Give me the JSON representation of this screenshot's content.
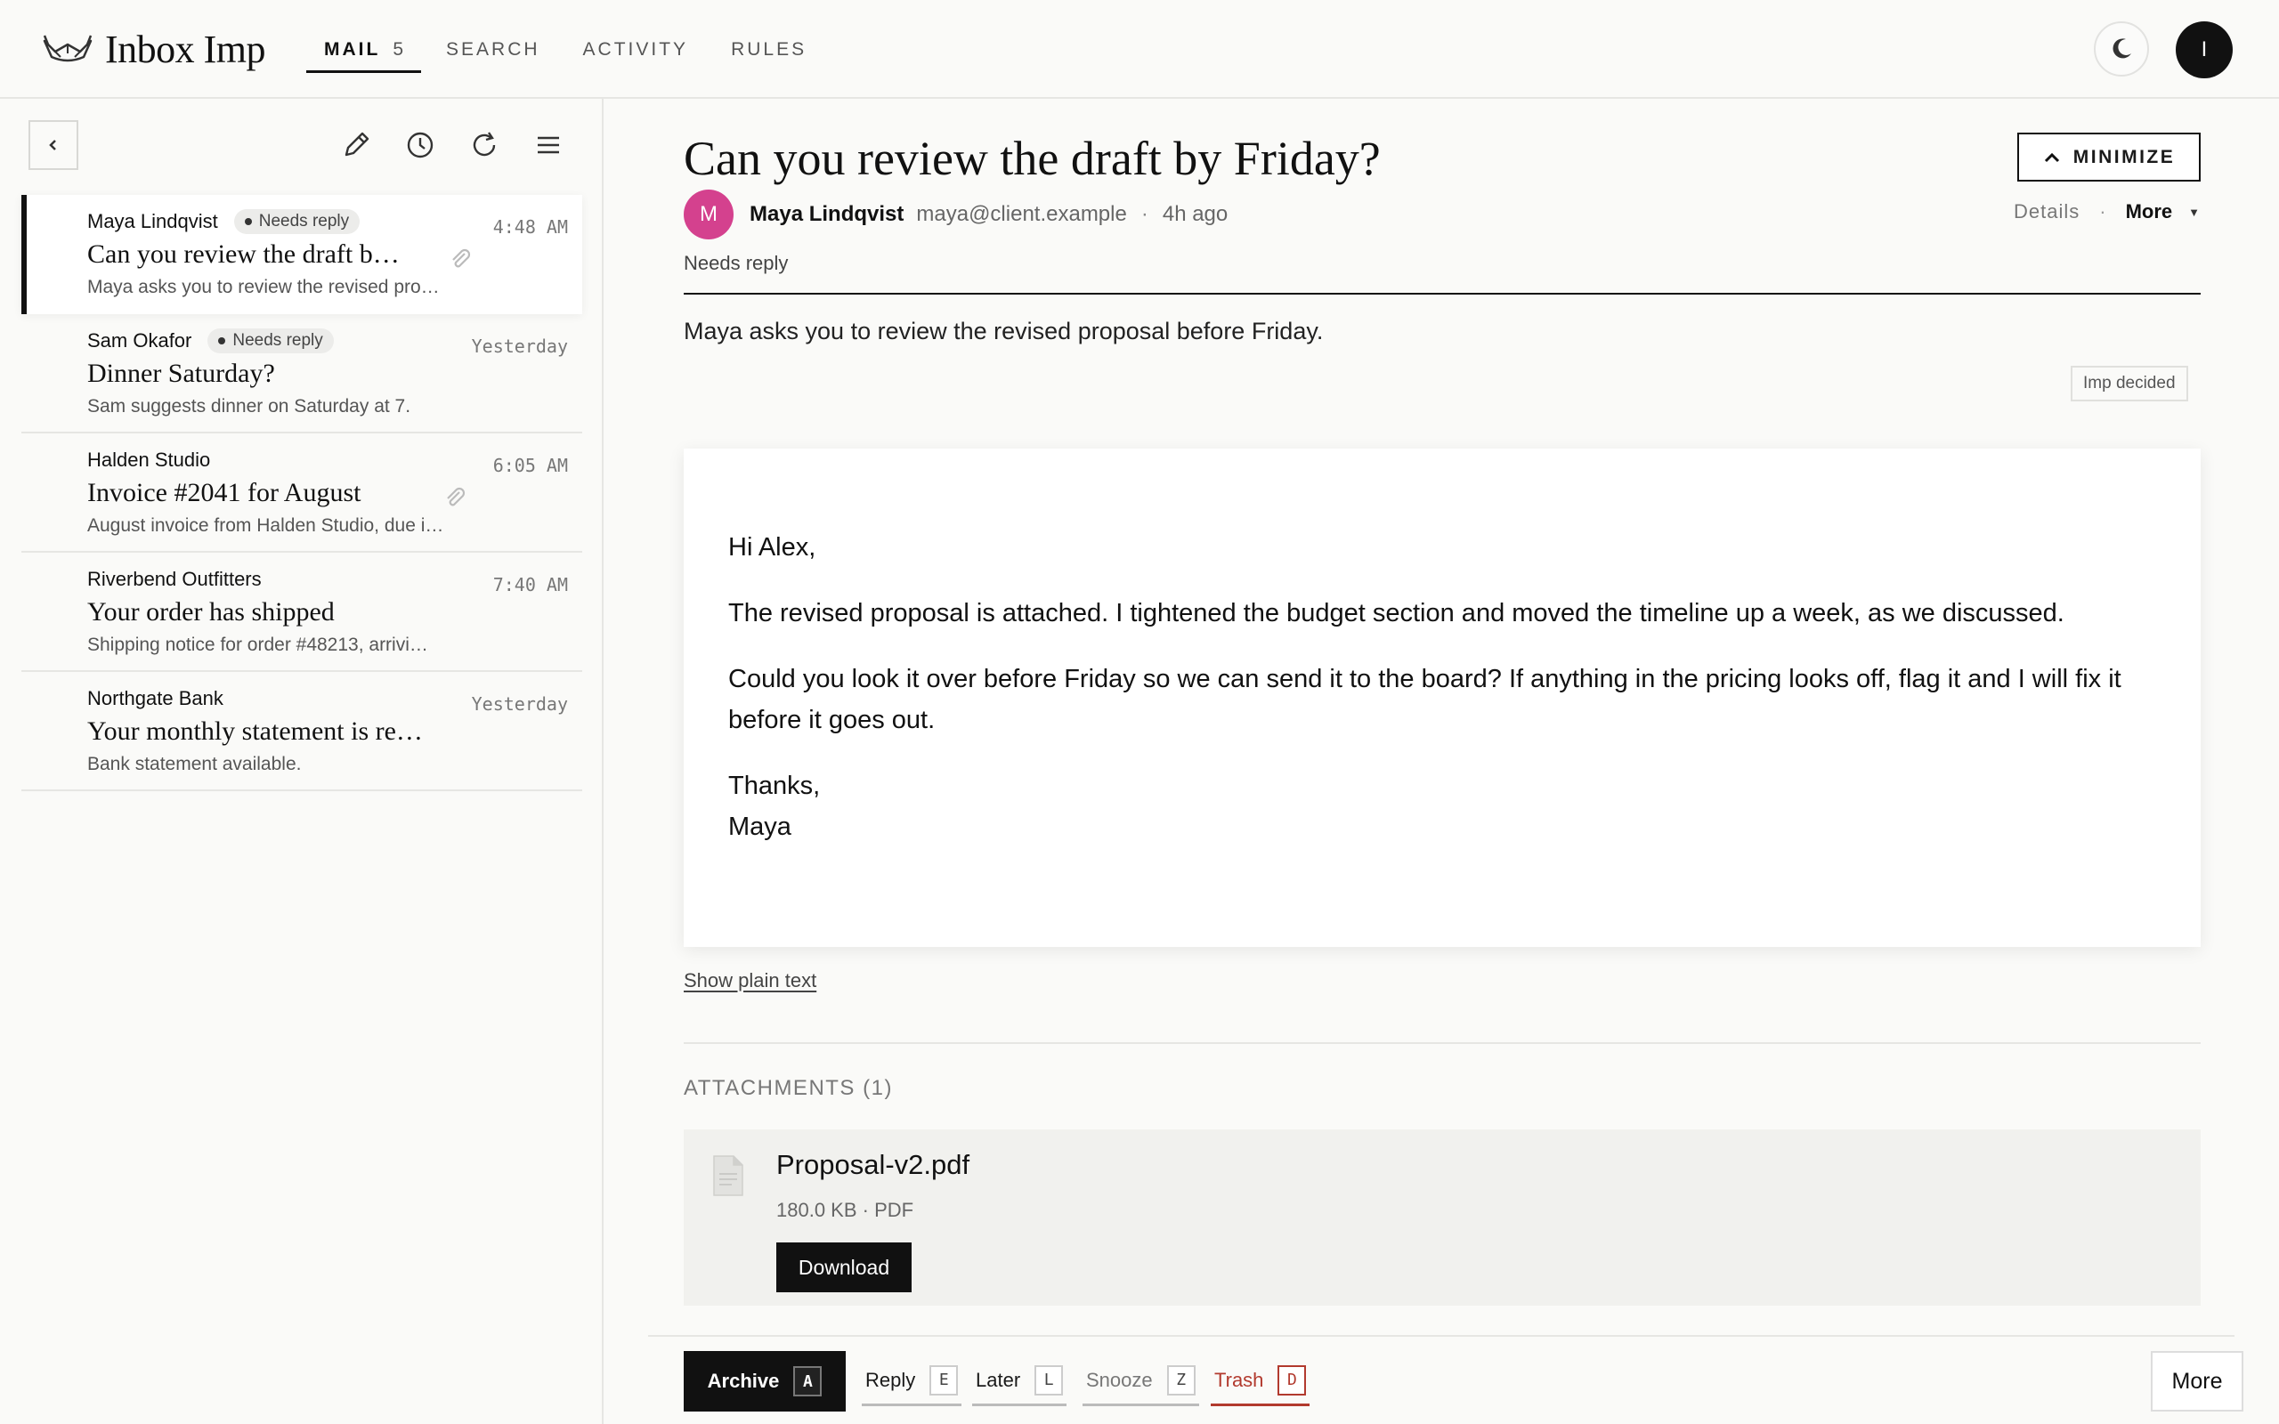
{
  "app": {
    "title": "Inbox Imp"
  },
  "nav": {
    "mail": "MAIL",
    "mail_count": "5",
    "search": "SEARCH",
    "activity": "ACTIVITY",
    "rules": "RULES"
  },
  "user": {
    "initial": "I"
  },
  "messages": [
    {
      "sender": "Maya Lindqvist",
      "badge": "Needs reply",
      "subject": "Can you review the draft b…",
      "snippet": "Maya asks you to review the revised pro…",
      "time": "4:48 AM"
    },
    {
      "sender": "Sam Okafor",
      "badge": "Needs reply",
      "subject": "Dinner Saturday?",
      "snippet": "Sam suggests dinner on Saturday at 7.",
      "time": "Yesterday"
    },
    {
      "sender": "Halden Studio",
      "subject": "Invoice #2041 for August",
      "snippet": "August invoice from Halden Studio, due i…",
      "time": "6:05 AM"
    },
    {
      "sender": "Riverbend Outfitters",
      "subject": "Your order has shipped",
      "snippet": "Shipping notice for order #48213, arrivi…",
      "time": "7:40 AM"
    },
    {
      "sender": "Northgate Bank",
      "subject": "Your monthly statement is re…",
      "snippet": "Bank statement available.",
      "time": "Yesterday"
    }
  ],
  "email": {
    "subject": "Can you review the draft by Friday?",
    "minimize_label": "MINIMIZE",
    "sender_initial": "M",
    "sender_name": "Maya Lindqvist",
    "sender_email": "maya@client.example",
    "separator": "·",
    "time": "4h ago",
    "details_label": "Details",
    "more_label": "More",
    "status": "Needs reply",
    "summary": "Maya asks you to review the revised proposal before Friday.",
    "imp_tag": "Imp decided",
    "body": {
      "greeting": "Hi Alex,",
      "p1": "The revised proposal is attached. I tightened the budget section and moved the timeline up a week, as we discussed.",
      "p2": "Could you look it over before Friday so we can send it to the board? If anything in the pricing looks off, flag it and I will fix it before it goes out.",
      "closing": "Thanks,",
      "signature": "Maya"
    },
    "plain_text_link": "Show plain text",
    "attachments_heading": "ATTACHMENTS (1)",
    "attachment": {
      "name": "Proposal-v2.pdf",
      "meta": "180.0 KB · PDF",
      "download": "Download"
    }
  },
  "actions": {
    "archive": "Archive",
    "archive_key": "A",
    "reply": "Reply",
    "reply_key": "E",
    "later": "Later",
    "later_key": "L",
    "snooze": "Snooze",
    "snooze_key": "Z",
    "trash": "Trash",
    "trash_key": "D",
    "more": "More"
  },
  "colors": {
    "accent": "#111111",
    "avatar": "#d4418e",
    "danger": "#b23a2e"
  }
}
